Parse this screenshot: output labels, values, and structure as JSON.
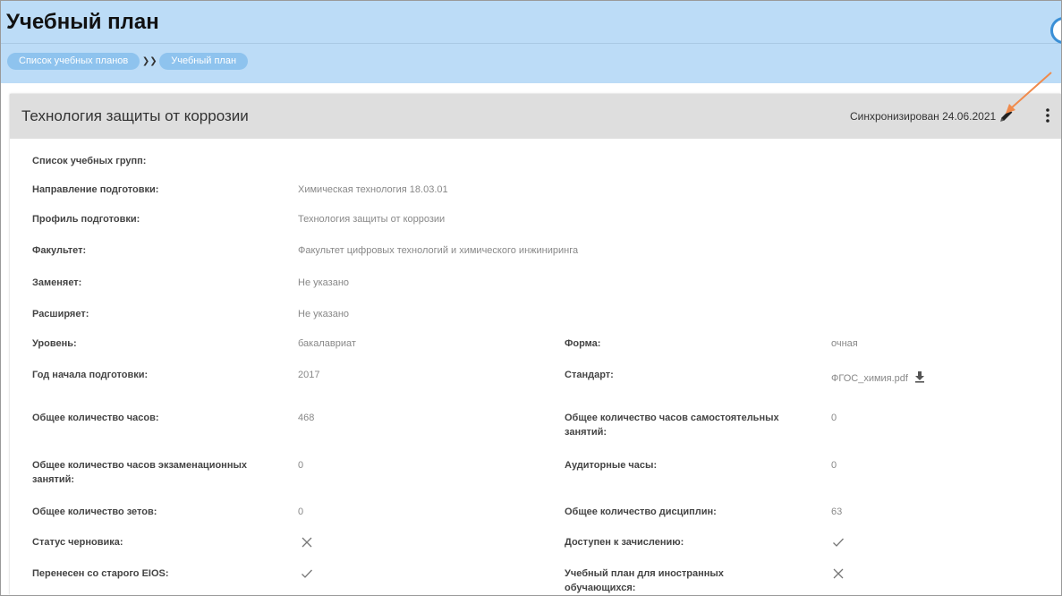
{
  "header": {
    "title": "Учебный план",
    "breadcrumbs": [
      "Список учебных планов",
      "Учебный план"
    ]
  },
  "plan": {
    "title": "Технология защиты от коррозии",
    "sync_status": "Синхронизирован 24.06.2021"
  },
  "fields": {
    "groups_label": "Список учебных групп:",
    "direction_label": "Направление подготовки:",
    "direction_value": "Химическая технология 18.03.01",
    "profile_label": "Профиль подготовки:",
    "profile_value": "Технология защиты от коррозии",
    "faculty_label": "Факультет:",
    "faculty_value": "Факультет цифровых технологий и химического инжиниринга",
    "replaces_label": "Заменяет:",
    "replaces_value": "Не указано",
    "extends_label": "Расширяет:",
    "extends_value": "Не указано",
    "level_label": "Уровень:",
    "level_value": "бакалавриат",
    "form_label": "Форма:",
    "form_value": "очная",
    "start_year_label": "Год начала подготовки:",
    "start_year_value": "2017",
    "standard_label": "Стандарт:",
    "standard_value": "ФГОС_химия.pdf",
    "total_hours_label": "Общее количество часов:",
    "total_hours_value": "468",
    "self_study_label": "Общее количество часов самостоятельных занятий:",
    "self_study_value": "0",
    "exam_hours_label": "Общее количество часов экзаменационных занятий:",
    "exam_hours_value": "0",
    "classroom_label": "Аудиторные часы:",
    "classroom_value": "0",
    "credits_label": "Общее количество зетов:",
    "credits_value": "0",
    "disciplines_label": "Общее количество дисциплин:",
    "disciplines_value": "63",
    "draft_label": "Статус черновика:",
    "draft_value": "cross",
    "enroll_label": "Доступен к зачислению:",
    "enroll_value": "check",
    "migrated_label": "Перенесен со старого EIOS:",
    "migrated_value": "check",
    "foreign_label": "Учебный план для иностранных обучающихся:",
    "foreign_value": "cross"
  },
  "icons": {
    "edit": "pencil-icon",
    "more": "more-vertical-icon",
    "download": "download-icon",
    "breadcrumb_separator": "double-chevron-right-icon",
    "help": "help-circle-icon"
  },
  "colors": {
    "header_bg": "#bcdcf7",
    "crumb_bg": "#8ec3ee",
    "card_head_bg": "#dedede",
    "annotation_arrow": "#f08a4b"
  }
}
